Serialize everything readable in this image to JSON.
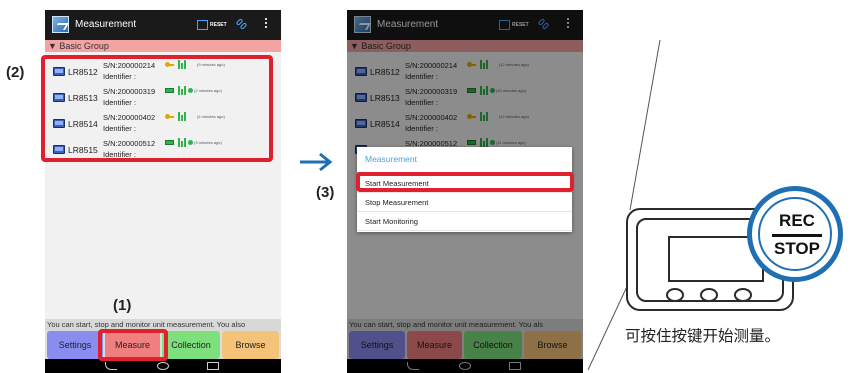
{
  "app": {
    "title": "Measurement",
    "reset_label": "RESET"
  },
  "group_header": "▼ Basic Group",
  "devices": [
    {
      "model": "LR8512",
      "serial": "S/N:200000214",
      "identifier": "Identifier :",
      "battery": "key",
      "connected": false,
      "ago": "(9 minutes ago)"
    },
    {
      "model": "LR8513",
      "serial": "S/N:200000319",
      "identifier": "Identifier :",
      "battery": "bar",
      "connected": true,
      "ago": "(2 minutes ago)"
    },
    {
      "model": "LR8514",
      "serial": "S/N:200000402",
      "identifier": "Identifier :",
      "battery": "key",
      "connected": false,
      "ago": "(4 minutes ago)"
    },
    {
      "model": "LR8515",
      "serial": "S/N:200000512",
      "identifier": "Identifier :",
      "battery": "bar",
      "connected": true,
      "ago": "(3 minutes ago)"
    }
  ],
  "devices_phone2": [
    {
      "ago": "(12 minutes ago)"
    },
    {
      "ago": "(10 minutes ago)"
    },
    {
      "ago": "(12 minutes ago)"
    },
    {
      "ago": "(11 minutes ago)"
    }
  ],
  "status_message": "You can start, stop and monitor unit measurement. You also",
  "status_message_2": "You can start, stop and monitor unit measurement. You als",
  "tabs": {
    "settings": "Settings",
    "measure": "Measure",
    "collection": "Collection",
    "browse": "Browse"
  },
  "dialog": {
    "title": "Measurement",
    "options": [
      "Start Measurement",
      "Stop Measurement",
      "Start Monitoring"
    ]
  },
  "steps": {
    "one": "(1)",
    "two": "(2)",
    "three": "(3)"
  },
  "rec_button": {
    "top": "REC",
    "bottom": "STOP"
  },
  "caption": "可按住按键开始测量。",
  "colors": {
    "highlight": "#e0202c",
    "rec_ring": "#1f6fb5",
    "dialog_title": "#4aa3d8"
  }
}
